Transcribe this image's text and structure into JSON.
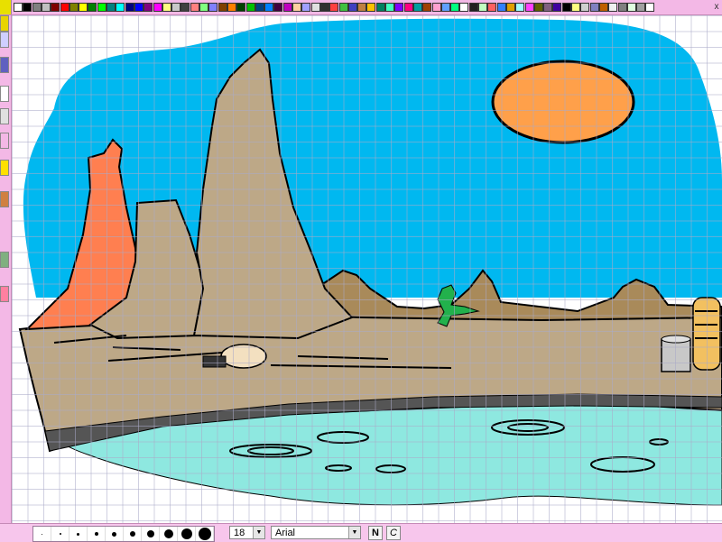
{
  "palette": {
    "colors": [
      "#ffffff",
      "#000000",
      "#808080",
      "#c0c0c0",
      "#800000",
      "#ff0000",
      "#808000",
      "#ffff00",
      "#008000",
      "#00ff00",
      "#008080",
      "#00ffff",
      "#000080",
      "#0000ff",
      "#800080",
      "#ff00ff",
      "#fffd80",
      "#c8c8c8",
      "#404040",
      "#ff8080",
      "#80ff80",
      "#8080ff",
      "#804000",
      "#ff8000",
      "#004000",
      "#00c000",
      "#004080",
      "#0080ff",
      "#400040",
      "#c000c0",
      "#ffd0a0",
      "#a0a0ff",
      "#e0e0e0",
      "#303030",
      "#ff4040",
      "#40c040",
      "#4040c0",
      "#c08040",
      "#ffc000",
      "#008060",
      "#40ffc0",
      "#8000ff",
      "#ff0080",
      "#00a0a0",
      "#a04000",
      "#ffa0d0",
      "#60a0ff",
      "#00ff80",
      "#ffffff",
      "#202020",
      "#c0ffc0",
      "#ff6060",
      "#3080ff",
      "#e0a000",
      "#a0ffff",
      "#ff40ff",
      "#606000",
      "#806080",
      "#4000a0",
      "#000000",
      "#ffff80",
      "#d0d0d0",
      "#8080c0",
      "#c06000",
      "#f0f0f0",
      "#808080",
      "#e0ffe0",
      "#a0a0a0",
      "#ffffff"
    ],
    "close_label": "x"
  },
  "tools": [
    {
      "name": "logo-icon",
      "bg": "#e8d400"
    },
    {
      "name": "select-tool-icon",
      "bg": "#cfcfff"
    },
    {
      "name": "color-picker-icon",
      "bg": "#6060c0"
    },
    {
      "name": "pointer-icon",
      "bg": "#ffffff"
    },
    {
      "name": "text-tool-icon",
      "bg": "#e0e0e0"
    },
    {
      "name": "line-tool-icon",
      "bg": "#f3b8e6"
    },
    {
      "name": "smiley-stamp-icon",
      "bg": "#ffe000"
    },
    {
      "name": "bug-stamp-icon",
      "bg": "#d08040"
    },
    {
      "name": "landscape-icon",
      "bg": "#80b080"
    },
    {
      "name": "current-color-swatch",
      "bg": "#ff80a0"
    }
  ],
  "bottom": {
    "brush_sizes": [
      1,
      2,
      3,
      4,
      5,
      6,
      8,
      10,
      12,
      14
    ],
    "font_size": "18",
    "font_name": "Arial",
    "bold_label": "N",
    "italic_label": "C"
  }
}
